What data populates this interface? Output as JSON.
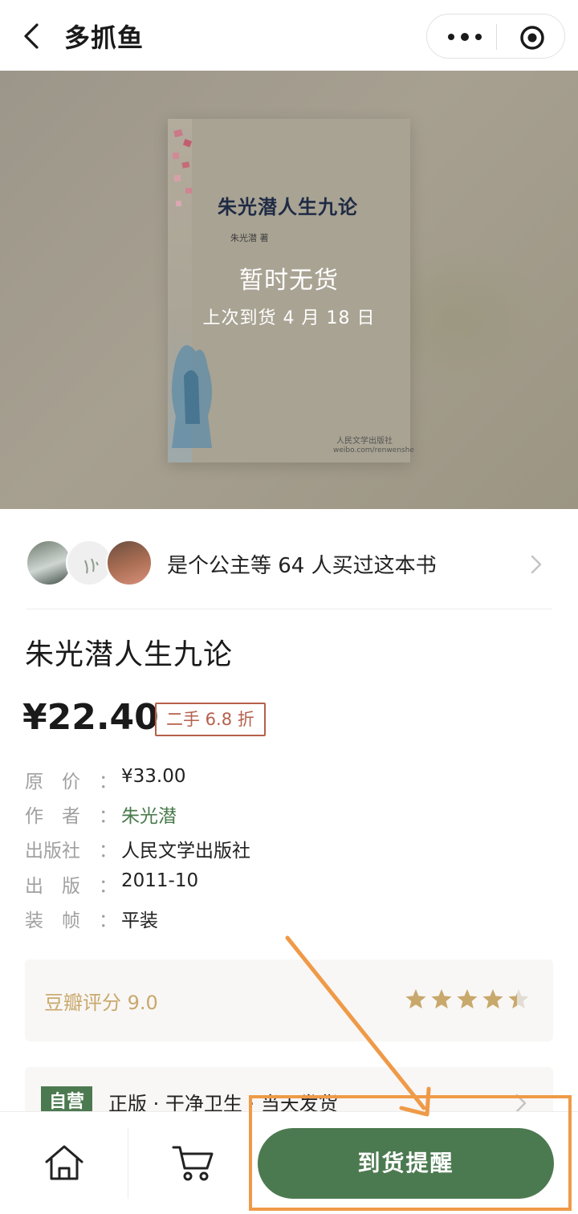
{
  "header": {
    "title": "多抓鱼",
    "icons": [
      "chevron-left-icon",
      "more-dots-icon",
      "target-icon"
    ]
  },
  "hero": {
    "status_title": "暂时无货",
    "status_sub": "上次到货 4 月 18 日",
    "cover": {
      "title": "朱光潜人生九论",
      "author": "朱光潜 著",
      "publisher": "人民文学出版社",
      "url": "weibo.com/renwenshe"
    }
  },
  "buyers": {
    "text": "是个公主等 64 人买过这本书"
  },
  "product": {
    "title": "朱光潜人生九论",
    "price": "¥22.40",
    "badge": "二手 6.8 折"
  },
  "info": [
    {
      "label": "原　价",
      "value": "¥33.00"
    },
    {
      "label": "作　者",
      "value": "朱光潜"
    },
    {
      "label": "出版社",
      "value": "人民文学出版社"
    },
    {
      "label": "出　版",
      "value": "2011-10"
    },
    {
      "label": "装　帧",
      "value": "平装"
    }
  ],
  "colon": "：",
  "rating": {
    "text": "豆瓣评分 9.0",
    "stars": 4.5
  },
  "promo": {
    "tag": "自营",
    "text": "正版 · 干净卫生 · 当天发货"
  },
  "bottom": {
    "notify_label": "到货提醒"
  },
  "colors": {
    "accent_green": "#4c7a50",
    "badge_red": "#b5604c",
    "rating_gold": "#c9a86c",
    "annotation_orange": "#ef9a48"
  }
}
